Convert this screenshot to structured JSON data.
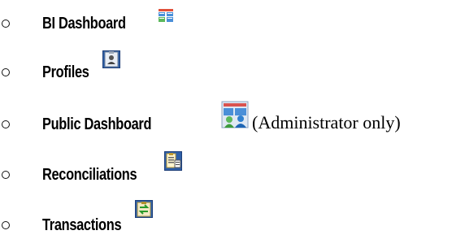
{
  "items": [
    {
      "label": "BI Dashboard",
      "icon": "bi-dashboard-icon"
    },
    {
      "label": "Profiles",
      "icon": "profiles-icon"
    },
    {
      "label": "Public Dashboard",
      "icon": "public-dashboard-icon",
      "note": "(Administrator only)"
    },
    {
      "label": "Reconciliations",
      "icon": "reconciliations-icon"
    },
    {
      "label": "Transactions",
      "icon": "transactions-icon"
    }
  ]
}
